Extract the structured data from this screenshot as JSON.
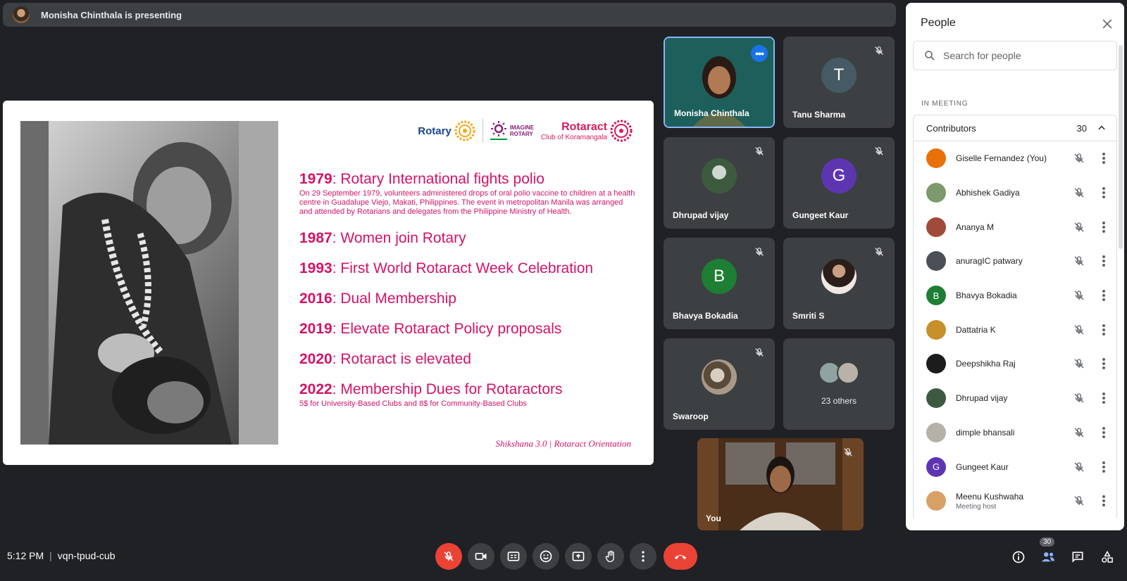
{
  "presenting": {
    "text": "Monisha Chinthala is presenting"
  },
  "slide": {
    "logos": {
      "rotary": "Rotary",
      "imagine_line1": "IMAGINE",
      "imagine_line2": "ROTARY",
      "rotaract": "Rotaract",
      "rotaract_club": "Club of Koramangala"
    },
    "timeline": [
      {
        "year": "1979",
        "title": ": Rotary International fights polio",
        "desc": "On 29 September 1979, volunteers administered drops of oral polio vaccine to children at a health centre in Guadalupe Viejo, Makati, Philippines. The event in metropolitan Manila was arranged and attended by Rotarians and delegates from the Philippine Ministry of Health."
      },
      {
        "year": "1987",
        "title": ": Women join Rotary",
        "desc": ""
      },
      {
        "year": "1993",
        "title": ": First World Rotaract Week Celebration",
        "desc": ""
      },
      {
        "year": "2016",
        "title": ": Dual Membership",
        "desc": ""
      },
      {
        "year": "2019",
        "title": ": Elevate Rotaract Policy proposals",
        "desc": ""
      },
      {
        "year": "2020",
        "title": ": Rotaract is elevated",
        "desc": ""
      },
      {
        "year": "2022",
        "title": ": Membership Dues for Rotaractors",
        "desc": "5$ for University-Based Clubs and 8$ for Community-Based Clubs"
      }
    ],
    "footer": "Shikshana 3.0  |  Rotaract Orientation"
  },
  "tiles": {
    "monisha": "Monisha Chinthala",
    "tanu": "Tanu Sharma",
    "tanu_initial": "T",
    "dhrupad": "Dhrupad vijay",
    "gungeet": "Gungeet Kaur",
    "gungeet_initial": "G",
    "bhavya": "Bhavya Bokadia",
    "bhavya_initial": "B",
    "smriti": "Smriti S",
    "swaroop": "Swaroop",
    "others": "23 others",
    "self": "You"
  },
  "people_panel": {
    "title": "People",
    "search_placeholder": "Search for people",
    "section_label": "IN MEETING",
    "group_label": "Contributors",
    "group_count": "30",
    "people": [
      {
        "name": "Giselle Fernandez (You)",
        "role": "",
        "initial": "",
        "color": "#e8710a"
      },
      {
        "name": "Abhishek Gadiya",
        "role": "",
        "initial": "",
        "color": "#7c9a6b"
      },
      {
        "name": "Ananya M",
        "role": "",
        "initial": "",
        "color": "#a04a3a"
      },
      {
        "name": "anuragIC patwary",
        "role": "",
        "initial": "",
        "color": "#4a4f58"
      },
      {
        "name": "Bhavya Bokadia",
        "role": "",
        "initial": "B",
        "color": "#1e7e34"
      },
      {
        "name": "Dattatria K",
        "role": "",
        "initial": "",
        "color": "#c7902a"
      },
      {
        "name": "Deepshikha Raj",
        "role": "",
        "initial": "",
        "color": "#1c1c1c"
      },
      {
        "name": "Dhrupad vijay",
        "role": "",
        "initial": "",
        "color": "#3c5a40"
      },
      {
        "name": "dimple bhansali",
        "role": "",
        "initial": "",
        "color": "#b5b0a8"
      },
      {
        "name": "Gungeet Kaur",
        "role": "",
        "initial": "G",
        "color": "#5e35b1"
      },
      {
        "name": "Meenu Kushwaha",
        "role": "Meeting host",
        "initial": "",
        "color": "#d9a066"
      }
    ]
  },
  "bottom_bar": {
    "time": "5:12 PM",
    "meeting_code": "vqn-tpud-cub",
    "people_badge": "30"
  },
  "colors": {
    "accent": "#1a73e8",
    "danger": "#ea4335",
    "slide_text": "#d41367",
    "background": "#202124"
  }
}
